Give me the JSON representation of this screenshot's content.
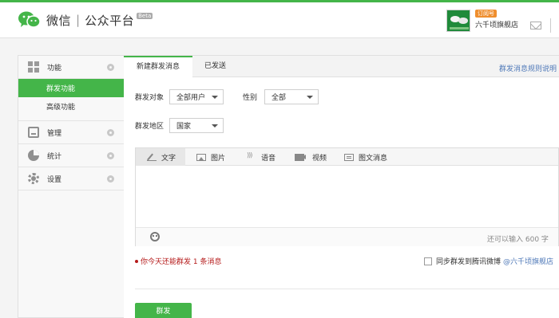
{
  "header": {
    "logo_text": "微信",
    "separator": "|",
    "platform_title": "公众平台",
    "beta_label": "Beta",
    "account_type_badge": "订阅号",
    "account_name": "六千顷旗舰店"
  },
  "sidebar": {
    "groups": [
      {
        "label": "功能",
        "icon": "grid-icon"
      },
      {
        "label": "管理",
        "icon": "tray-icon"
      },
      {
        "label": "统计",
        "icon": "pie-chart-icon"
      },
      {
        "label": "设置",
        "icon": "gear-icon"
      }
    ],
    "function_subitems": [
      {
        "label": "群发功能",
        "active": true
      },
      {
        "label": "高级功能",
        "active": false
      }
    ]
  },
  "tabs": {
    "new_message": "新建群发消息",
    "sent": "已发送",
    "rules_link": "群发消息规则说明"
  },
  "form": {
    "target_label": "群发对象",
    "target_value": "全部用户",
    "gender_label": "性别",
    "gender_value": "全部",
    "region_label": "群发地区",
    "region_value": "国家"
  },
  "editor": {
    "tools": [
      {
        "label": "文字",
        "icon": "pencil-icon",
        "active": true
      },
      {
        "label": "图片",
        "icon": "image-icon"
      },
      {
        "label": "语音",
        "icon": "voice-icon"
      },
      {
        "label": "视频",
        "icon": "video-icon"
      },
      {
        "label": "图文消息",
        "icon": "news-icon"
      }
    ],
    "remaining_chars": "还可以输入 600 字"
  },
  "notice": {
    "daily_limit": "你今天还能群发 1 条消息",
    "sync_label": "同步群发到腾讯微博",
    "sync_account": "@六千顷旗舰店"
  },
  "actions": {
    "send_label": "群发"
  },
  "colors": {
    "accent": "#44b549",
    "link": "#4f79b8",
    "warning": "#b51a1a",
    "badge": "#ef8e2e"
  }
}
